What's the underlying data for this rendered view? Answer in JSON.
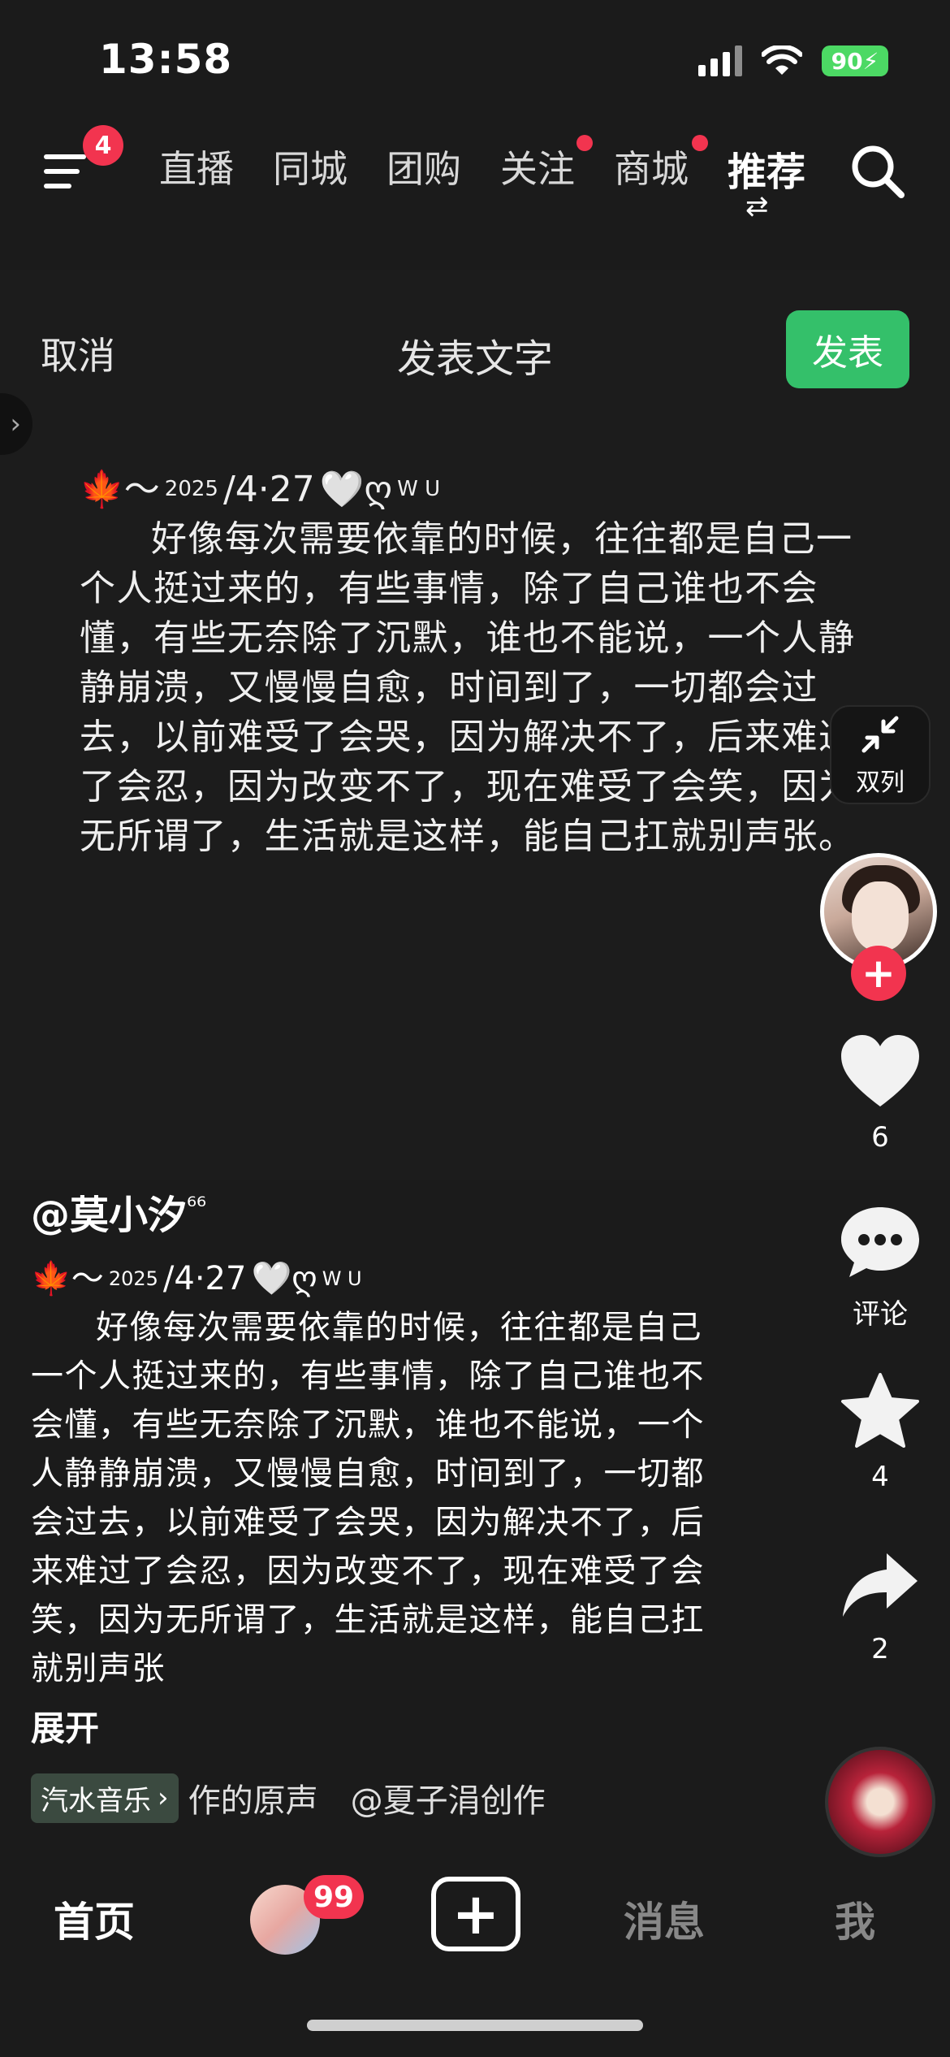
{
  "status": {
    "time": "13:58",
    "battery": "90"
  },
  "topnav": {
    "menu_badge": "4",
    "tabs": [
      {
        "label": "直播",
        "dot": false
      },
      {
        "label": "同城",
        "dot": false
      },
      {
        "label": "团购",
        "dot": false
      },
      {
        "label": "关注",
        "dot": true
      },
      {
        "label": "商城",
        "dot": true
      },
      {
        "label": "推荐",
        "active": true
      }
    ]
  },
  "compose": {
    "cancel": "取消",
    "title": "发表文字",
    "publish": "发表",
    "head_prefix": "🍁～",
    "head_year": "2025",
    "head_date": "/4·27",
    "head_suffix": "🤍ღ",
    "head_sup": "W U",
    "body": "好像每次需要依靠的时候，往往都是自己一个人挺过来的，有些事情，除了自己谁也不会懂，有些无奈除了沉默，谁也不能说，一个人静静崩溃，又慢慢自愈，时间到了，一切都会过去，以前难受了会哭，因为解决不了，后来难过了会忍，因为改变不了，现在难受了会笑，因为无所谓了，生活就是这样，能自己扛就别声张。",
    "dual_label": "双列"
  },
  "actions": {
    "likes": "6",
    "comment_label": "评论",
    "favorites": "4",
    "shares": "2"
  },
  "caption": {
    "author": "@莫小汐",
    "author_sup": "⁶⁶",
    "head_prefix": "🍁～",
    "head_year": "2025",
    "head_date": "/4·27",
    "head_suffix": "🤍ღ",
    "head_sup": "W U",
    "body": "好像每次需要依靠的时候，往往都是自己一个人挺过来的，有些事情，除了自己谁也不会懂，有些无奈除了沉默，谁也不能说，一个人静静崩溃，又慢慢自愈，时间到了，一切都会过去，以前难受了会哭，因为解决不了，后来难过了会忍，因为改变不了，现在难受了会笑，因为无所谓了，生活就是这样，能自己扛就别声张",
    "expand": "展开",
    "music_tag": "汽水音乐",
    "music_text": "作的原声　@夏子涓创作"
  },
  "tabbar": {
    "home": "首页",
    "friends_badge": "99",
    "messages": "消息",
    "me": "我"
  }
}
